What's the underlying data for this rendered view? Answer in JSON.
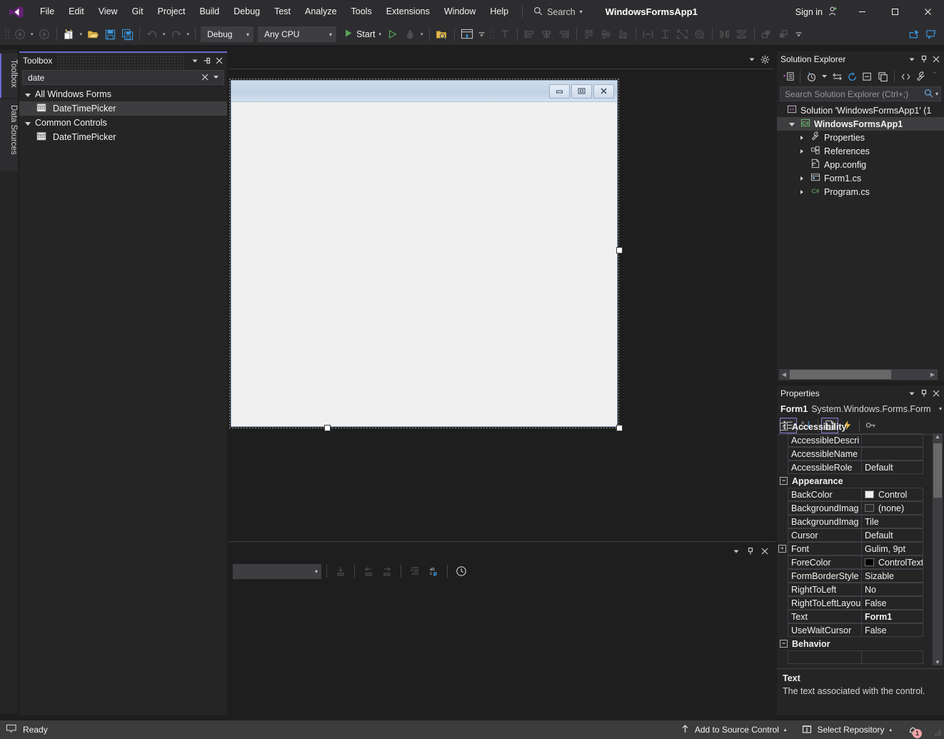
{
  "titlebar": {
    "logo_icon": "visual-studio-logo-icon",
    "menus": [
      "File",
      "Edit",
      "View",
      "Git",
      "Project",
      "Build",
      "Debug",
      "Test",
      "Analyze",
      "Tools",
      "Extensions",
      "Window",
      "Help"
    ],
    "search": {
      "icon": "search-icon",
      "label": "Search",
      "caret": "▾"
    },
    "solution_title": "WindowsFormsApp1",
    "sign_in": {
      "label": "Sign in",
      "icon": "account-add-icon"
    },
    "window_buttons": {
      "minimize": "—",
      "maximize": "☐",
      "close": "✕"
    }
  },
  "toolbar": {
    "navigate_back_icon": "navigate-back-icon",
    "navigate_forward_icon": "navigate-forward-icon",
    "new_project_icon": "new-project-icon",
    "open_file_icon": "open-file-icon",
    "save_icon": "save-icon",
    "save_all_icon": "save-all-icon",
    "undo_icon": "undo-icon",
    "redo_icon": "redo-icon",
    "configuration": "Debug",
    "platform": "Any CPU",
    "start_label": "Start",
    "start_icon": "play-icon",
    "start_no_debug_icon": "play-outline-icon",
    "hot_reload_icon": "hot-reload-flame-icon",
    "open_folder_search_icon": "folder-search-icon",
    "window_layout_icon": "window-layout-icon",
    "tab_order_icon": "tab-order-icon",
    "align_lefts_icon": "align-lefts-icon",
    "align_centers_icon": "align-centers-icon",
    "align_rights_icon": "align-rights-icon",
    "align_tops_icon": "align-tops-icon",
    "align_middles_icon": "align-middles-icon",
    "align_bottoms_icon": "align-bottoms-icon",
    "make_same_width_icon": "make-same-width-icon",
    "make_same_height_icon": "make-same-height-icon",
    "make_same_size_icon": "make-same-size-icon",
    "size_to_grid_icon": "size-to-grid-icon",
    "horizontal_spacing_icon": "horizontal-spacing-icon",
    "vertical_spacing_icon": "vertical-spacing-icon",
    "bring_to_front_icon": "bring-to-front-icon",
    "send_to_back_icon": "send-to-back-icon",
    "overflow_icon": "toolbar-overflow-icon",
    "dropdown_caret": "▾"
  },
  "left_tabs": [
    {
      "label": "Toolbox",
      "active": true
    },
    {
      "label": "Data Sources",
      "active": false
    }
  ],
  "toolbox": {
    "title": "Toolbox",
    "header_buttons": [
      "chevron-down-icon",
      "unpin-icon",
      "close-icon"
    ],
    "search_value": "date",
    "search_clear_icon": "clear-icon",
    "search_dropdown_icon": "chevron-down-icon",
    "groups": [
      {
        "label": "All Windows Forms",
        "expanded": true,
        "items": [
          {
            "label": "DateTimePicker",
            "icon": "datetimepicker-icon",
            "selected": true
          }
        ]
      },
      {
        "label": "Common Controls",
        "expanded": true,
        "items": [
          {
            "label": "DateTimePicker",
            "icon": "datetimepicker-icon",
            "selected": false
          }
        ]
      }
    ]
  },
  "designer": {
    "tabstrip_buttons": [
      "chevron-down-icon",
      "gear-icon"
    ],
    "form": {
      "title": "",
      "minimize_icon": "minimize-icon",
      "maximize_icon": "maximize-icon",
      "close_icon": "close-icon",
      "selected": true
    }
  },
  "bottom_panel": {
    "header_buttons": [
      "chevron-down-icon",
      "pin-icon",
      "close-icon"
    ],
    "combo_value": "",
    "combo_caret": "▾",
    "toolbar_icons": [
      "stack-frame-icon",
      "step-out-left-icon",
      "step-in-right-icon",
      "unindent-icon",
      "toggle-word-wrap-icon",
      "history-clock-icon"
    ]
  },
  "solution_explorer": {
    "title": "Solution Explorer",
    "header_buttons": [
      "chevron-down-icon",
      "pin-icon",
      "close-icon"
    ],
    "toolbar_icons": [
      "code-map-icon",
      "pending-changes-icon",
      "pending-changes-caret-icon",
      "sync-with-active-document-icon",
      "refresh-icon",
      "collapse-all-icon",
      "show-all-files-icon",
      "view-code-icon",
      "properties-wrench-icon",
      "more-options-icon"
    ],
    "search_placeholder": "Search Solution Explorer (Ctrl+;)",
    "search_icon": "search-icon",
    "search_caret": "▾",
    "tree": [
      {
        "label": "Solution 'WindowsFormsApp1'  (1",
        "icon": "solution-icon",
        "indent": 14,
        "expander": "",
        "selected": false,
        "bold": false
      },
      {
        "label": "WindowsFormsApp1",
        "icon": "csharp-project-icon",
        "indent": 14,
        "expander": "open",
        "selected": true,
        "bold": true
      },
      {
        "label": "Properties",
        "icon": "properties-wrench-icon",
        "indent": 33,
        "expander": "closed",
        "selected": false,
        "bold": false
      },
      {
        "label": "References",
        "icon": "references-icon",
        "indent": 33,
        "expander": "closed",
        "selected": false,
        "bold": false
      },
      {
        "label": "App.config",
        "icon": "config-file-icon",
        "indent": 33,
        "expander": "",
        "selected": false,
        "bold": false
      },
      {
        "label": "Form1.cs",
        "icon": "windows-form-icon",
        "indent": 33,
        "expander": "closed",
        "selected": false,
        "bold": false
      },
      {
        "label": "Program.cs",
        "icon": "csharp-file-icon",
        "indent": 33,
        "expander": "closed",
        "selected": false,
        "bold": false
      }
    ],
    "hscroll": {
      "left_arrow": "◀",
      "right_arrow": "▶"
    }
  },
  "properties": {
    "title": "Properties",
    "header_buttons": [
      "chevron-down-icon",
      "pin-icon",
      "close-icon"
    ],
    "object_name": "Form1",
    "object_type": "System.Windows.Forms.Form",
    "object_caret": "▾",
    "toolbar_icons": [
      "categorized-icon",
      "alphabetical-icon",
      "properties-page-icon",
      "events-lightning-icon",
      "property-pages-key-icon"
    ],
    "rows": [
      {
        "kind": "category",
        "label": "Accessibility",
        "sign": "−"
      },
      {
        "kind": "prop",
        "name": "AccessibleDescri",
        "value": "",
        "swatch": null,
        "expander": false,
        "bold": false
      },
      {
        "kind": "prop",
        "name": "AccessibleName",
        "value": "",
        "swatch": null,
        "expander": false,
        "bold": false
      },
      {
        "kind": "prop",
        "name": "AccessibleRole",
        "value": "Default",
        "swatch": null,
        "expander": false,
        "bold": false
      },
      {
        "kind": "category",
        "label": "Appearance",
        "sign": "−"
      },
      {
        "kind": "prop",
        "name": "BackColor",
        "value": "Control",
        "swatch": "#f0f0f0",
        "expander": false,
        "bold": false
      },
      {
        "kind": "prop",
        "name": "BackgroundImag",
        "value": "(none)",
        "swatch": "#2b2b2b",
        "expander": false,
        "bold": false
      },
      {
        "kind": "prop",
        "name": "BackgroundImag",
        "value": "Tile",
        "swatch": null,
        "expander": false,
        "bold": false
      },
      {
        "kind": "prop",
        "name": "Cursor",
        "value": "Default",
        "swatch": null,
        "expander": false,
        "bold": false
      },
      {
        "kind": "prop",
        "name": "Font",
        "value": "Gulim, 9pt",
        "swatch": null,
        "expander": true,
        "bold": false
      },
      {
        "kind": "prop",
        "name": "ForeColor",
        "value": "ControlText",
        "swatch": "#000000",
        "expander": false,
        "bold": false
      },
      {
        "kind": "prop",
        "name": "FormBorderStyle",
        "value": "Sizable",
        "swatch": null,
        "expander": false,
        "bold": false
      },
      {
        "kind": "prop",
        "name": "RightToLeft",
        "value": "No",
        "swatch": null,
        "expander": false,
        "bold": false
      },
      {
        "kind": "prop",
        "name": "RightToLeftLayou",
        "value": "False",
        "swatch": null,
        "expander": false,
        "bold": false
      },
      {
        "kind": "prop",
        "name": "Text",
        "value": "Form1",
        "swatch": null,
        "expander": false,
        "bold": true
      },
      {
        "kind": "prop",
        "name": "UseWaitCursor",
        "value": "False",
        "swatch": null,
        "expander": false,
        "bold": false
      },
      {
        "kind": "category",
        "label": "Behavior",
        "sign": "−"
      }
    ],
    "scroll_up_icon": "▲",
    "scroll_down_icon": "▼",
    "description": {
      "title": "Text",
      "text": "The text associated with the control."
    }
  },
  "statusbar": {
    "status_icon": "ready-icon",
    "status_text": "Ready",
    "add_to_source_control": {
      "label": "Add to Source Control",
      "icon": "arrow-up-icon",
      "caret": "▴"
    },
    "select_repository": {
      "label": "Select Repository",
      "icon": "repository-icon",
      "caret": "▴"
    },
    "notifications": {
      "icon": "bell-icon",
      "count": "1"
    },
    "resize_grip_icon": "resize-grip-icon"
  },
  "colors": {
    "accent": "#6a6ad0",
    "chrome": "#2d2d30",
    "panel": "#252526",
    "editor": "#1e1e1e",
    "statusbar": "#3c3c3c",
    "badge": "#f4a3a8",
    "form_titlebar": "#c4d4e6"
  }
}
